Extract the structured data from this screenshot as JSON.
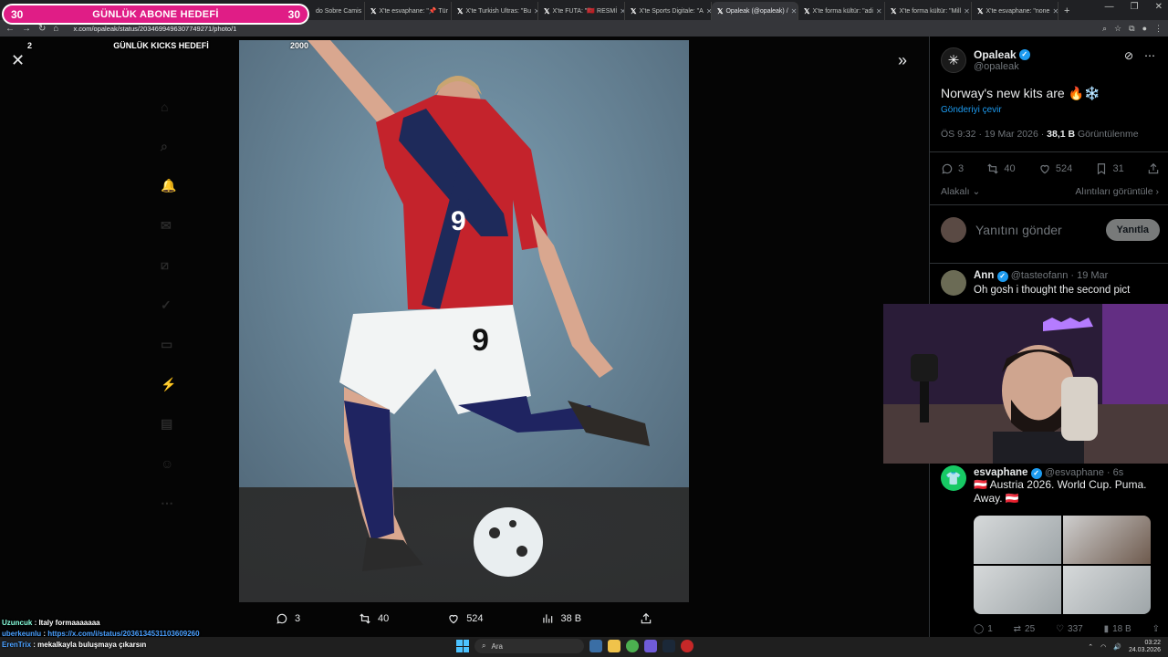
{
  "browser": {
    "tabs": [
      {
        "label": "do Sobre Camis"
      },
      {
        "label": "X'te esvaphane: \"📌 Tür"
      },
      {
        "label": "X'te Turkish Ultras: \"Bu"
      },
      {
        "label": "X'te FUTA: \"🇲🇦 RESMİ"
      },
      {
        "label": "X'te Sports Digitale: \"A"
      },
      {
        "label": "Opaleak (@opaleak) /",
        "active": true
      },
      {
        "label": "X'te forma kültür: \"adi"
      },
      {
        "label": "X'te forma kültür: \"Mill"
      },
      {
        "label": "X'te esvaphane: \"none"
      }
    ],
    "url": "x.com/opaleak/status/2034699496307749271/photo/1"
  },
  "overlay": {
    "goal1_left": "30",
    "goal1_title": "GÜNLÜK ABONE HEDEFİ",
    "goal1_right": "30",
    "goal2_left": "2",
    "goal2_title": "GÜNLÜK KICKS HEDEFİ",
    "goal2_right": "2000"
  },
  "photo_actions": {
    "replies": "3",
    "reposts": "40",
    "likes": "524",
    "views": "38 B"
  },
  "tweet": {
    "author_name": "Opaleak",
    "author_handle": "@opaleak",
    "text": "Norway's new kits are 🔥❄️",
    "translate": "Gönderiyi çevir",
    "time": "ÖS 9:32 · 19 Mar 2026 ·",
    "views_count": "38,1 B",
    "views_label": "Görüntülenme",
    "replies": "3",
    "reposts": "40",
    "likes": "524",
    "bookmarks": "31",
    "related": "Alakalı",
    "quotes": "Alıntıları görüntüle",
    "reply_placeholder": "Yanıtını gönder",
    "reply_button": "Yanıtla"
  },
  "reply1": {
    "name": "Ann",
    "handle": "@tasteofann · 19 Mar",
    "text": "Oh gosh i thought the second pict"
  },
  "tweet2": {
    "name": "esvaphane",
    "handle": "@esvaphane · 6s",
    "text": "🇦🇹 Austria 2026. World Cup. Puma. Away. 🇦🇹",
    "replies": "1",
    "reposts": "25",
    "likes": "337",
    "views": "18 B"
  },
  "chat": [
    {
      "user": "Uzuncuk",
      "msg": "Italy formaaaaaaa"
    },
    {
      "user": "uberkeunlu",
      "msg": "https://x.com/i/status/2036134531103609260",
      "link": true
    },
    {
      "user": "ErenTrix",
      "msg": "mekalkayla buluşmaya çıkarsın"
    }
  ],
  "taskbar": {
    "search": "Ara",
    "time": "03:22",
    "date": "24.03.2026"
  }
}
